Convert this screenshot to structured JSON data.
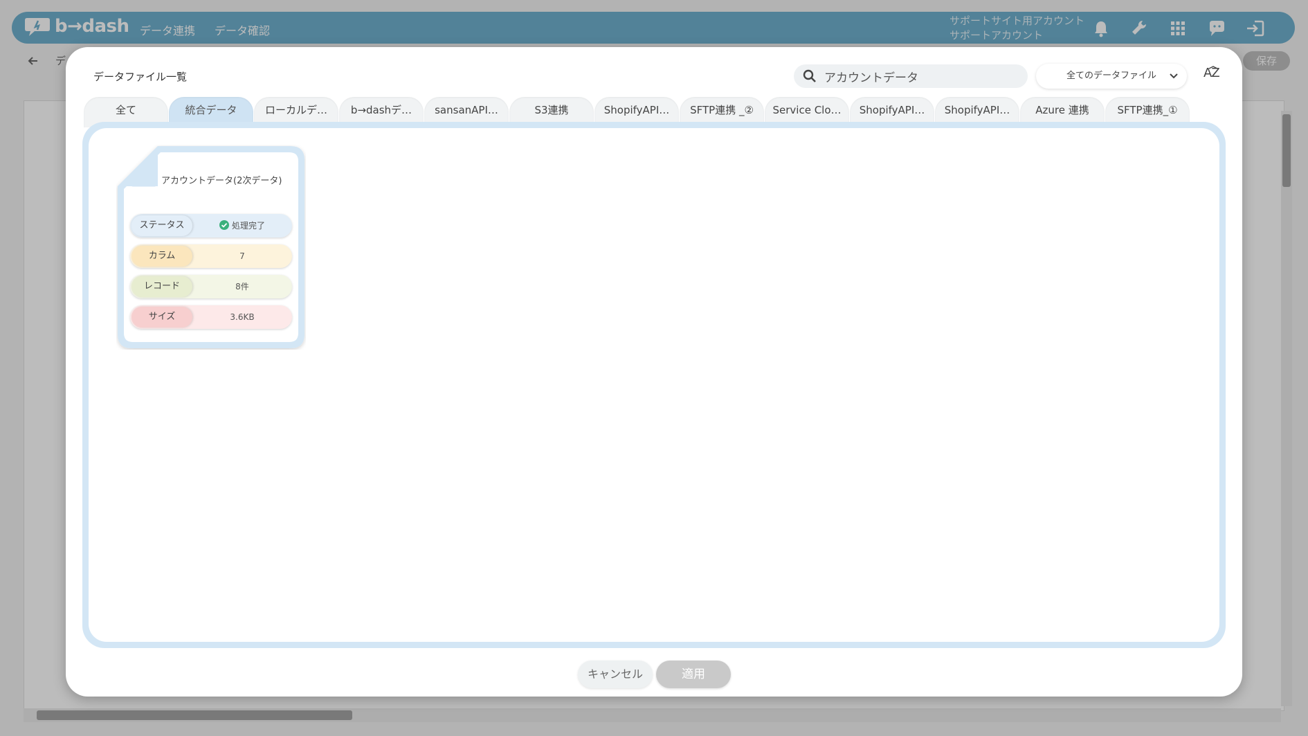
{
  "app": {
    "logo_text": "b→dash",
    "nav": [
      "データ連携",
      "データ確認"
    ],
    "account_line1": "サポートサイト用アカウント",
    "account_line2": "サポートアカウント",
    "save_label": "保存",
    "breadcrumb_char": "デ"
  },
  "modal": {
    "title": "データファイル一覧",
    "search": {
      "value": "アカウントデータ"
    },
    "filter": {
      "selected": "全てのデータファイル"
    },
    "sort_label": "AZ",
    "tabs": [
      {
        "label": "全て"
      },
      {
        "label": "統合データ",
        "active": true
      },
      {
        "label": "ローカルデ…"
      },
      {
        "label": "b→dashデ…"
      },
      {
        "label": "sansanAPI…"
      },
      {
        "label": "S3連携"
      },
      {
        "label": "ShopifyAPI…"
      },
      {
        "label": "SFTP連携 _②"
      },
      {
        "label": "Service Clo…"
      },
      {
        "label": "ShopifyAPI…"
      },
      {
        "label": "ShopifyAPI…"
      },
      {
        "label": "Azure 連携"
      },
      {
        "label": "SFTP連携_①"
      }
    ],
    "card": {
      "title": "アカウントデータ(2次データ)",
      "rows": [
        {
          "label": "ステータス",
          "value": "処理完了",
          "color": "#e3eef8",
          "label_color": "#e3eef8"
        },
        {
          "label": "カラム",
          "value": "7",
          "color": "#fdf3dc",
          "label_color": "#fbe6bd"
        },
        {
          "label": "レコード",
          "value": "8件",
          "color": "#f3f6e6",
          "label_color": "#e7edd0"
        },
        {
          "label": "サイズ",
          "value": "3.6KB",
          "color": "#fde9e9",
          "label_color": "#f7cfcf"
        }
      ]
    },
    "cancel_label": "キャンセル",
    "apply_label": "適用"
  }
}
